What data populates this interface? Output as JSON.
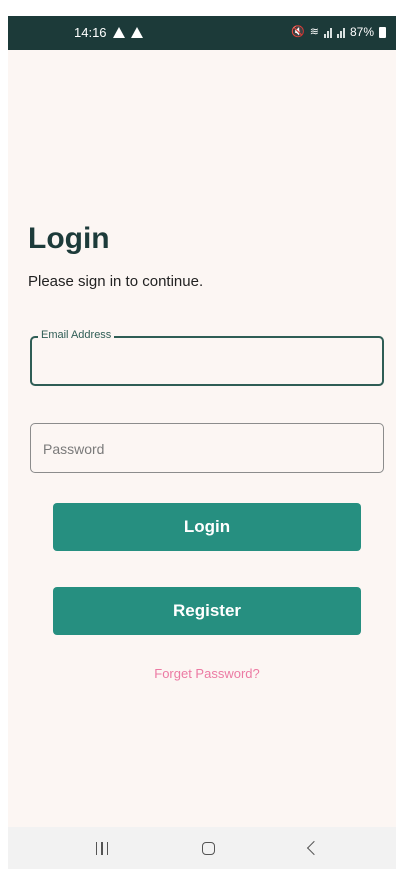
{
  "status_bar": {
    "time": "14:16",
    "battery": "87%",
    "icons": [
      "warning-icon",
      "warning-icon",
      "mute-icon",
      "wifi-icon",
      "signal-icon",
      "signal-icon",
      "battery-icon"
    ]
  },
  "login": {
    "title": "Login",
    "subtitle": "Please sign in to continue.",
    "email_label": "Email Address",
    "email_value": "",
    "password_placeholder": "Password",
    "password_value": "",
    "login_button": "Login",
    "register_button": "Register",
    "forgot_link": "Forget Password?"
  },
  "nav_bar": {
    "icons": [
      "recent-apps-icon",
      "home-icon",
      "back-icon"
    ]
  },
  "colors": {
    "primary": "#268f80",
    "title": "#1d3b3a",
    "status_bar": "#1c3a39",
    "link": "#ec7aa3",
    "background": "#fcf6f3"
  }
}
